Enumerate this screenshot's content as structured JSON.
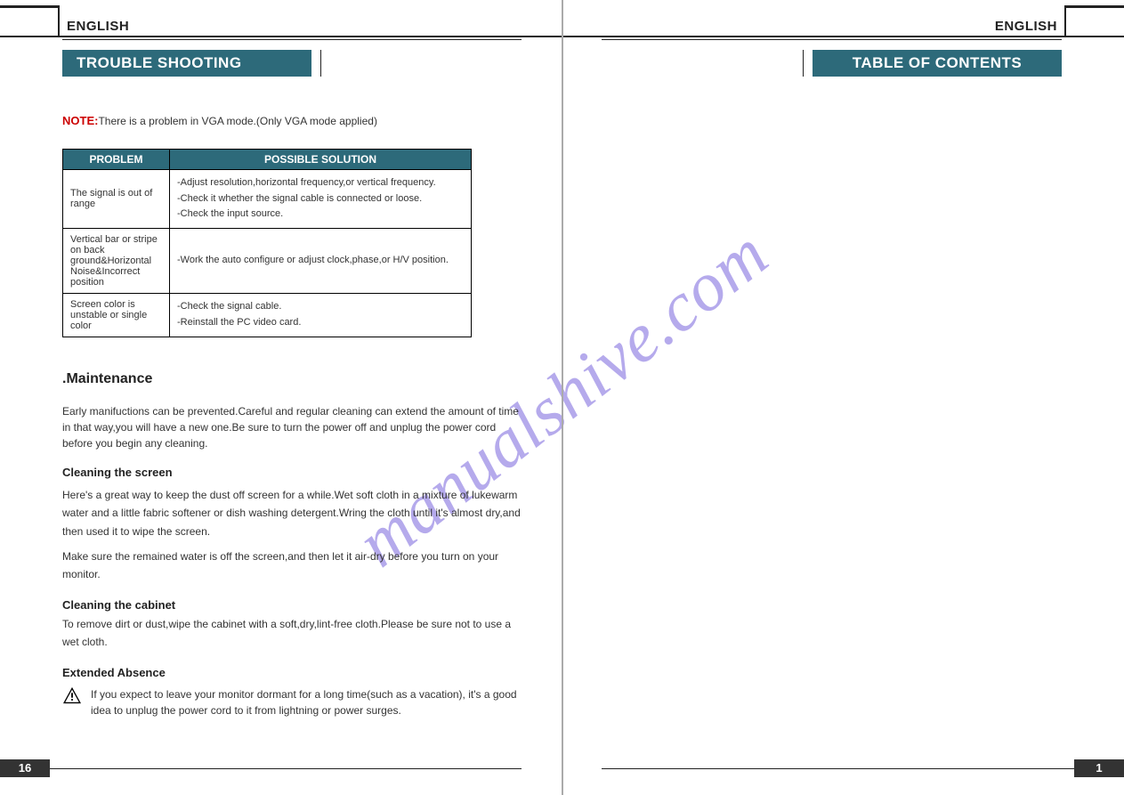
{
  "watermark": "manualshive.com",
  "left": {
    "lang": "ENGLISH",
    "title": "TROUBLE SHOOTING",
    "note_label": "NOTE:",
    "note_text": "There is a problem in VGA mode.(Only VGA mode applied)",
    "table": {
      "head_problem": "PROBLEM",
      "head_solution": "POSSIBLE SOLUTION",
      "rows": [
        {
          "problem": "The signal is out of range",
          "solution": "-Adjust resolution,horizontal frequency,or vertical frequency.\n-Check it whether the signal cable is connected or loose.\n-Check the input source."
        },
        {
          "problem": "Vertical bar or stripe on back ground&Horizontal Noise&Incorrect position",
          "solution": "-Work the auto configure or adjust clock,phase,or H/V position."
        },
        {
          "problem": "Screen color is unstable or single color",
          "solution": "-Check the signal cable.\n-Reinstall the PC video card."
        }
      ]
    },
    "maintenance_h": ".Maintenance",
    "maintenance_p": "Early manifuctions can be prevented.Careful and regular cleaning can extend the amount of time in that way,you will have a new one.Be sure to turn the power off and unplug the power cord before you begin any cleaning.",
    "clean_screen_h": "Cleaning the screen",
    "clean_screen_p1": " Here's a great way to keep the dust off screen for a while.Wet soft cloth in a mixture of lukewarm water and a little fabric softener or dish washing detergent.Wring the cloth until it's almost dry,and then used it to wipe the screen.",
    "clean_screen_p2": "Make sure the remained water is off the screen,and then let it air-dry before you turn on your monitor.",
    "clean_cabinet_h": "Cleaning the cabinet",
    "clean_cabinet_p": "To remove dirt or dust,wipe the cabinet with a soft,dry,lint-free cloth.Please be sure not to use a wet cloth.",
    "extended_h": "Extended Absence",
    "extended_p": "If you expect to leave your monitor dormant for a long time(such as a vacation), it's a good idea to unplug the power cord to it from lightning or power surges.",
    "page_num": "16"
  },
  "right": {
    "lang": "ENGLISH",
    "title": "TABLE OF CONTENTS",
    "page_num": "1"
  }
}
